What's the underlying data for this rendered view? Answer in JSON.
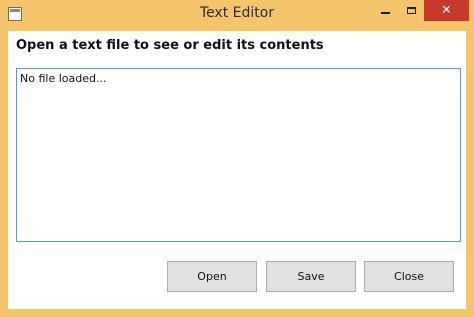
{
  "window": {
    "title": "Text Editor",
    "minimize_glyph": "minimize-icon",
    "maximize_glyph": "maximize-icon",
    "close_glyph": "✕"
  },
  "main": {
    "heading": "Open a text file to see or edit its contents",
    "editor_text": "No file loaded..."
  },
  "buttons": {
    "open_label": "Open",
    "save_label": "Save",
    "close_label": "Close"
  },
  "colors": {
    "frame": "#f4c56b",
    "close_button": "#c7392b",
    "editor_border": "#569de5",
    "button_face": "#e1e1e1"
  }
}
